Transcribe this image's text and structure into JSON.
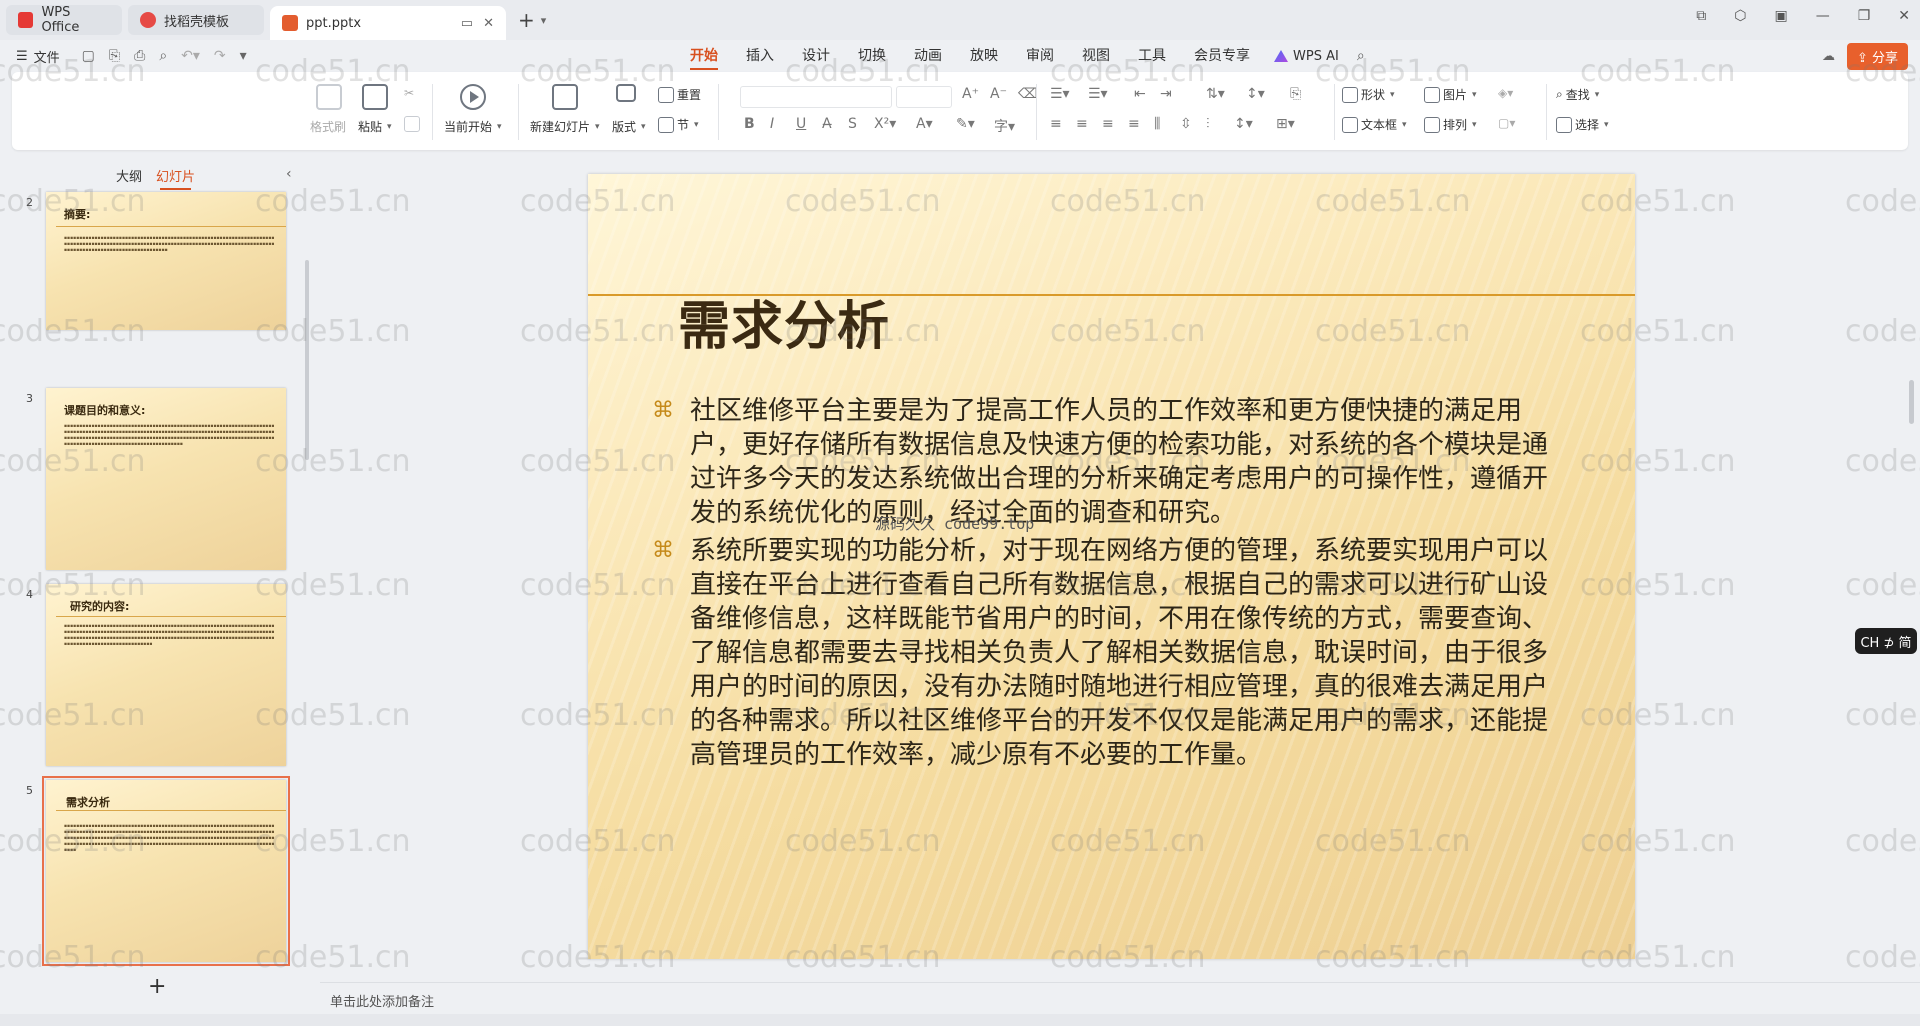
{
  "tabs": [
    {
      "label": "WPS Office",
      "icon": "wps-logo-icon"
    },
    {
      "label": "找稻壳模板",
      "icon": "template-icon"
    },
    {
      "label": "ppt.pptx",
      "icon": "ppt-file-icon",
      "active": true
    }
  ],
  "menubar": {
    "file_label": "文件",
    "items": [
      "开始",
      "插入",
      "设计",
      "切换",
      "动画",
      "放映",
      "审阅",
      "视图",
      "工具",
      "会员专享"
    ],
    "active_item": "开始",
    "wps_ai_label": "WPS AI",
    "share_label": "分享"
  },
  "ribbon": {
    "format_painter": "格式刷",
    "paste": "粘贴",
    "play_from_current": "当前开始",
    "new_slide": "新建幻灯片",
    "layout": "版式",
    "reset": "重置",
    "section": "节",
    "shape": "形状",
    "picture": "图片",
    "textbox": "文本框",
    "arrange": "排列",
    "find": "查找",
    "select": "选择"
  },
  "left_panel": {
    "tab_outline": "大纲",
    "tab_slides": "幻灯片",
    "thumbnails": [
      {
        "number": "2",
        "title": "摘要:"
      },
      {
        "number": "3",
        "title": "课题目的和意义:"
      },
      {
        "number": "4",
        "title": "研究的内容:"
      },
      {
        "number": "5",
        "title": "需求分析",
        "selected": true
      }
    ]
  },
  "slide": {
    "title": "需求分析",
    "bullets": [
      "社区维修平台主要是为了提高工作人员的工作效率和更方便快捷的满足用户，更好存储所有数据信息及快速方便的检索功能，对系统的各个模块是通过许多今天的发达系统做出合理的分析来确定考虑用户的可操作性，遵循开发的系统优化的原则，经过全面的调查和研究。",
      "系统所要实现的功能分析，对于现在网络方便的管理，系统要实现用户可以直接在平台上进行查看自己所有数据信息，根据自己的需求可以进行矿山设备维修信息，这样既能节省用户的时间，不用在像传统的方式，需要查询、了解信息都需要去寻找相关负责人了解相关数据信息，耽误时间，由于很多用户的时间的原因，没有办法随时随地进行相应管理，真的很难去满足用户的各种需求。所以社区维修平台的开发不仅仅是能满足用户的需求，还能提高管理员的工作效率，减少原有不必要的工作量。"
    ],
    "overlay_text": "源码久久 code99.top"
  },
  "notes_placeholder": "单击此处添加备注",
  "ime_label": "CH ⊅ 简",
  "watermark": "code51.cn"
}
